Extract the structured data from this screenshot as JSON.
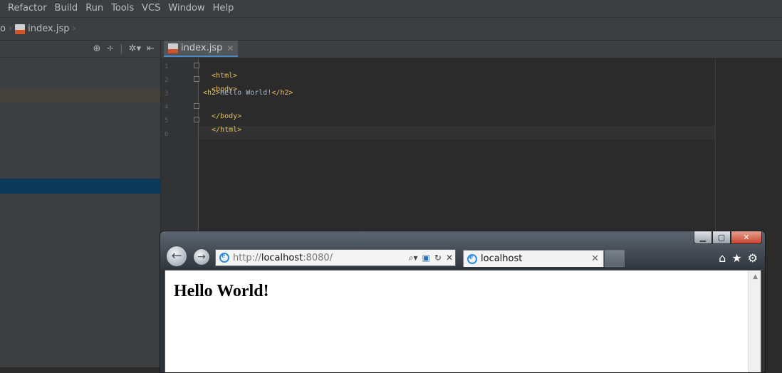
{
  "menubar": {
    "items": [
      "Refactor",
      "Build",
      "Run",
      "Tools",
      "VCS",
      "Window",
      "Help"
    ]
  },
  "breadcrumb": {
    "prefix": "o",
    "file": "index.jsp"
  },
  "editor": {
    "tab_label": "index.jsp",
    "lines": [
      {
        "num": "1"
      },
      {
        "num": "2"
      },
      {
        "num": "3"
      },
      {
        "num": "4"
      },
      {
        "num": "5"
      },
      {
        "num": "6"
      }
    ],
    "code": {
      "l1": "<html>",
      "l2": "<body>",
      "l3_open": "<h2>",
      "l3_text": "Hello World!",
      "l3_close": "</h2>",
      "l4": "</body>",
      "l5": "</html>"
    }
  },
  "icons": {
    "project_toolbar": [
      "target-icon",
      "collapse-icon",
      "gear-icon",
      "hide-panel-icon"
    ],
    "browser_commands": [
      "home-icon",
      "favorites-star-icon",
      "tools-gear-icon"
    ]
  },
  "browser": {
    "url_prefix": "http://",
    "url_host": "localhost",
    "url_port": ":8080/",
    "tab_title": "localhost",
    "page_heading": "Hello World!"
  },
  "colors": {
    "ide_bg": "#2b2b2b",
    "panel_bg": "#3c3f41",
    "selection": "#0d3a58",
    "tag": "#e8bf6a",
    "accent": "#4a88c7"
  }
}
